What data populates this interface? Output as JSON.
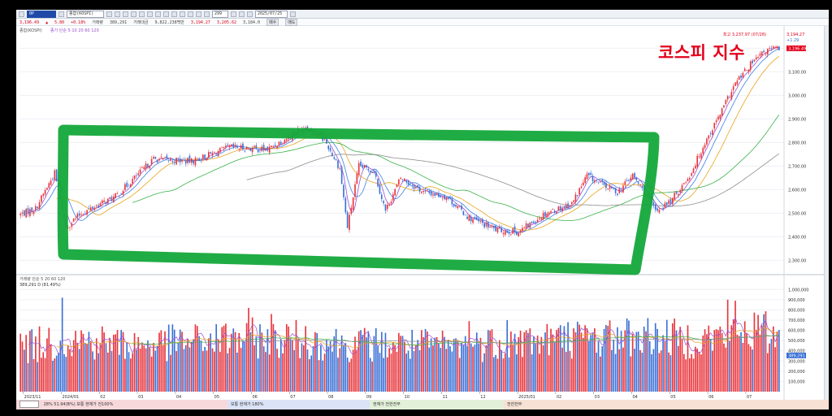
{
  "toolbar": {
    "code_value": "0P",
    "name_value": "종합(KOSPI)",
    "date_value": "2025/07/25",
    "count_value": "299"
  },
  "quote": {
    "price": "3,196.49",
    "change": "5.80",
    "rate": "+0.18%",
    "volume_label": "거래량",
    "volume": "389,291",
    "amount_label": "거래대금",
    "amount": "9,822,238백만",
    "high": "3,194.27",
    "low": "3,205.62",
    "third": "3,184.0",
    "tag1": "매수",
    "tag2": "매도"
  },
  "price_legend": {
    "title": "종합(KOSPI)",
    "ma": "종가 단순 5 10 20 60 120"
  },
  "volume_legend": {
    "title": "거래량 단순 5 20 60 120",
    "value": "389,291 D (81.49%)"
  },
  "extremes": {
    "high_note": "최고 3,237.97 (07/28)",
    "last_note": "+1.29",
    "price_tag": "3,196.49",
    "vol_tag": "389,291"
  },
  "annotation": "코스피 지수",
  "statusbar": {
    "left": "28% 51.94(B%)  보통  현재가  전100%",
    "mid": "보통  현재가  180%",
    "mid2": "현재가  전한전부",
    "right": "전한전부"
  },
  "colors": {
    "up": "#e8343b",
    "down": "#3a6fd6",
    "ma5": "#9b4fd0",
    "ma10": "#3d7fe0",
    "ma20": "#e9a31d",
    "ma60": "#3bb24a",
    "ma120": "#8d8d8d",
    "highlight": "#14a83a"
  },
  "chart_data": {
    "type": "candlestick",
    "price_axis": {
      "ticks": [
        3200,
        3100,
        3000,
        2900,
        2800,
        2700,
        2600,
        2500,
        2400,
        2300
      ],
      "tick_labels": [
        "3,200.00",
        "3,100.00",
        "3,000.00",
        "2,900.00",
        "2,800.00",
        "2,700.00",
        "2,600.00",
        "2,500.00",
        "2,400.00",
        "2,300.00"
      ],
      "ylim": [
        2260,
        3260
      ]
    },
    "volume_axis": {
      "ticks": [
        1000000,
        900000,
        800000,
        700000,
        600000,
        500000,
        400000,
        300000,
        200000,
        100000
      ],
      "tick_labels": [
        "1,000,000",
        "900,000",
        "800,000",
        "700,000",
        "600,000",
        "500,000",
        "400,000",
        "300,000",
        "200,000",
        "100,000"
      ],
      "ylim": [
        0,
        1050000
      ]
    },
    "x_tick_labels": [
      "2023/11",
      "2024/01",
      "02",
      "03",
      "04",
      "05",
      "06",
      "07",
      "08",
      "09",
      "10",
      "11",
      "12",
      "2025/01",
      "02",
      "03",
      "04",
      "05",
      "06",
      "07"
    ],
    "close_anchors": [
      [
        0,
        2495
      ],
      [
        8,
        2520
      ],
      [
        18,
        2670
      ],
      [
        24,
        2440
      ],
      [
        32,
        2500
      ],
      [
        50,
        2570
      ],
      [
        70,
        2730
      ],
      [
        90,
        2720
      ],
      [
        110,
        2780
      ],
      [
        130,
        2770
      ],
      [
        150,
        2870
      ],
      [
        160,
        2810
      ],
      [
        168,
        2690
      ],
      [
        172,
        2440
      ],
      [
        178,
        2700
      ],
      [
        186,
        2680
      ],
      [
        192,
        2510
      ],
      [
        200,
        2650
      ],
      [
        212,
        2590
      ],
      [
        224,
        2570
      ],
      [
        236,
        2480
      ],
      [
        250,
        2430
      ],
      [
        262,
        2420
      ],
      [
        276,
        2500
      ],
      [
        290,
        2540
      ],
      [
        298,
        2660
      ],
      [
        306,
        2620
      ],
      [
        314,
        2590
      ],
      [
        322,
        2660
      ],
      [
        328,
        2590
      ],
      [
        334,
        2510
      ],
      [
        342,
        2550
      ],
      [
        352,
        2660
      ],
      [
        360,
        2800
      ],
      [
        368,
        2920
      ],
      [
        376,
        3050
      ],
      [
        384,
        3130
      ],
      [
        392,
        3190
      ],
      [
        398,
        3200
      ]
    ],
    "volume_anchors": [
      [
        0,
        450000
      ],
      [
        30,
        520000
      ],
      [
        60,
        470000
      ],
      [
        90,
        500000
      ],
      [
        120,
        540000
      ],
      [
        150,
        520000
      ],
      [
        170,
        480000
      ],
      [
        200,
        470000
      ],
      [
        230,
        450000
      ],
      [
        250,
        500000
      ],
      [
        280,
        520000
      ],
      [
        300,
        540000
      ],
      [
        330,
        560000
      ],
      [
        350,
        520000
      ],
      [
        370,
        560000
      ],
      [
        385,
        620000
      ],
      [
        398,
        560000
      ]
    ],
    "volume_spikes": [
      [
        22,
        920000
      ],
      [
        120,
        820000
      ],
      [
        132,
        760000
      ],
      [
        236,
        690000
      ],
      [
        256,
        700000
      ],
      [
        288,
        680000
      ],
      [
        302,
        620000
      ],
      [
        372,
        900000
      ],
      [
        376,
        890000
      ],
      [
        390,
        650000
      ]
    ]
  }
}
